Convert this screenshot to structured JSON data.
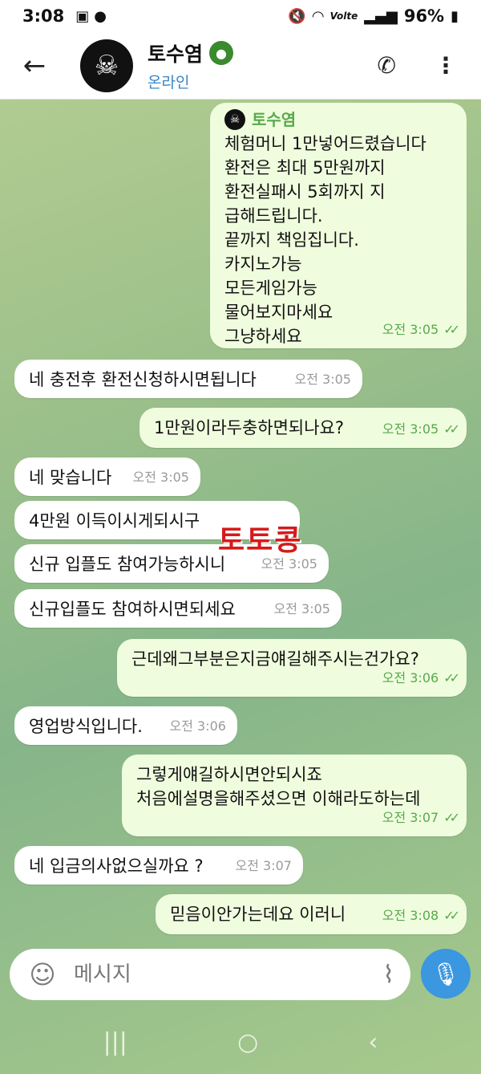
{
  "status": {
    "time": "3:08",
    "battery": "96%",
    "volte": "Volte"
  },
  "header": {
    "name": "토수염",
    "status": "온라인"
  },
  "messages": [
    {
      "direction": "out",
      "forwarded_from": "토수염",
      "text": "체험머니 1만넣어드렸습니다\n환전은 최대 5만원까지\n환전실패시 5회까지 지\n급해드립니다.\n끝까지 책임집니다.\n카지노가능\n모든게임가능\n물어보지마세요\n그냥하세요",
      "time": "오전 3:05"
    },
    {
      "direction": "in",
      "text": "네 충전후 환전신청하시면됩니다",
      "time": "오전 3:05"
    },
    {
      "direction": "out",
      "text": "1만원이라두충하면되나요?",
      "time": "오전 3:05"
    },
    {
      "direction": "in",
      "text": "네 맞습니다",
      "time": "오전 3:05"
    },
    {
      "direction": "in",
      "text": "4만원 이득이시게되시구",
      "time": ""
    },
    {
      "direction": "in",
      "text": "신규 입플도 참여가능하시니",
      "time": "오전 3:05"
    },
    {
      "direction": "in",
      "text": "신규입플도 참여하시면되세요",
      "time": "오전 3:05"
    },
    {
      "direction": "out",
      "text": "근데왜그부분은지금얘길해주시는건가요?",
      "time": "오전 3:06"
    },
    {
      "direction": "in",
      "text": "영업방식입니다.",
      "time": "오전 3:06"
    },
    {
      "direction": "out",
      "text": "그렇게얘길하시면안되시죠\n처음에설명을해주셨으면 이해라도하는데",
      "time": "오전 3:07"
    },
    {
      "direction": "in",
      "text": "네 입금의사없으실까요 ?",
      "time": "오전 3:07"
    },
    {
      "direction": "out",
      "text": "믿음이안가는데요 이러니",
      "time": "오전 3:08"
    }
  ],
  "watermark": "토토콩",
  "input": {
    "placeholder": "메시지"
  },
  "icons": {
    "back": "arrow-left-icon",
    "phone": "phone-icon",
    "more": "more-vertical-icon",
    "emoji": "emoji-icon",
    "attach": "paperclip-icon",
    "mic": "mic-icon"
  },
  "colors": {
    "outgoing_bubble": "#effdde",
    "incoming_bubble": "#ffffff",
    "accent_green": "#58a94c",
    "online_blue": "#3a86c8",
    "mic_blue": "#3a97e0"
  }
}
